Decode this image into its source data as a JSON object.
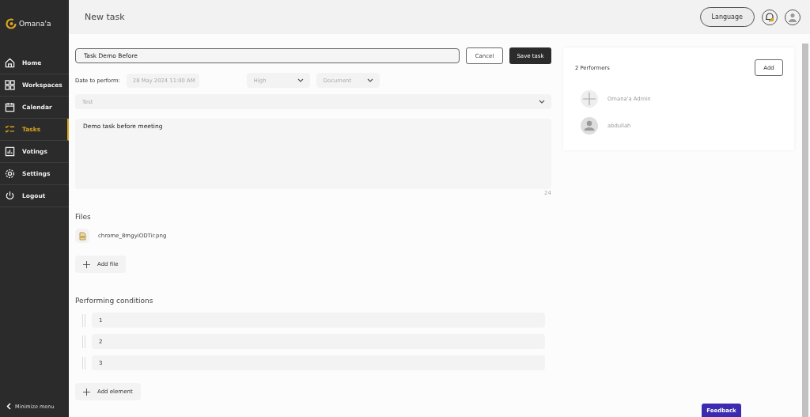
{
  "brand": {
    "name": "Omana'a"
  },
  "sidebar": {
    "items": [
      {
        "label": "Home",
        "selected": false
      },
      {
        "label": "Workspaces",
        "selected": false
      },
      {
        "label": "Calendar",
        "selected": false
      },
      {
        "label": "Tasks",
        "selected": true
      },
      {
        "label": "Votings",
        "selected": false
      },
      {
        "label": "Settings",
        "selected": false
      },
      {
        "label": "Logout",
        "selected": false
      }
    ],
    "minimize": "Minimize menu"
  },
  "header": {
    "title": "New task",
    "language": "Language"
  },
  "form": {
    "title_value": "Task Demo Before",
    "cancel": "Cancel",
    "save": "Save task",
    "date_label": "Date to perform:",
    "date_value": "28 May 2024 11:00 AM",
    "priority": "High",
    "type": "Document",
    "category": "Test",
    "description": "Demo task before meeting",
    "char_count": "24"
  },
  "files": {
    "heading": "Files",
    "items": [
      {
        "name": "chrome_8mgyiODTir.png"
      }
    ],
    "add": "Add file"
  },
  "conditions": {
    "heading": "Performing conditions",
    "items": [
      {
        "value": "1"
      },
      {
        "value": "2"
      },
      {
        "value": "3"
      }
    ],
    "add": "Add element"
  },
  "performers": {
    "heading": "2 Performers",
    "add": "Add",
    "items": [
      {
        "name": "Omana'a Admin",
        "kind": "add"
      },
      {
        "name": "abdullah",
        "kind": "user"
      }
    ]
  },
  "feedback": "Feedback"
}
